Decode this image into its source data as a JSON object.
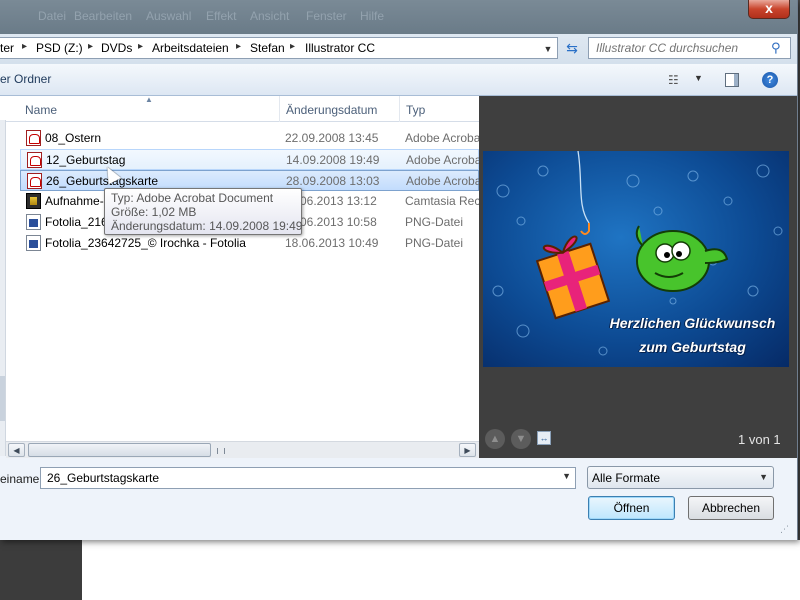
{
  "background": {
    "menu_faint": [
      "Datei",
      "Bearbeiten",
      "Auswahl",
      "Effekt",
      "Ansicht",
      "Fenster",
      "Hilfe"
    ]
  },
  "titlebar": {
    "close_label": "x"
  },
  "address": {
    "crumbs": [
      "ter",
      "PSD (Z:)",
      "DVDs",
      "Arbeitsdateien",
      "Stefan",
      "Illustrator CC"
    ],
    "search_placeholder": "Illustrator CC durchsuchen"
  },
  "toolbar": {
    "new_folder": "er Ordner"
  },
  "columns": {
    "name": "Name",
    "date": "Änderungsdatum",
    "type": "Typ"
  },
  "files": [
    {
      "name": "08_Ostern",
      "date": "22.09.2008 13:45",
      "type": "Adobe Acrobat Document",
      "icon": "pdf-icon"
    },
    {
      "name": "12_Geburtstag",
      "date": "14.09.2008 19:49",
      "type": "Adobe Acrobat Document",
      "icon": "pdf-icon"
    },
    {
      "name": "26_Geburtstagskarte",
      "date": "28.09.2008 13:03",
      "type": "Adobe Acrobat Document",
      "icon": "pdf-icon"
    },
    {
      "name": "Aufnahme-",
      "date": "06.2013 13:12",
      "type": "Camtasia Recording",
      "icon": "video-file-icon"
    },
    {
      "name": "Fotolia_216",
      "date": "06.2013 10:58",
      "type": "PNG-Datei",
      "icon": "png-file-icon"
    },
    {
      "name": "Fotolia_23642725_© Irochka - Fotolia",
      "date": "18.06.2013 10:49",
      "type": "PNG-Datei",
      "icon": "png-file-icon"
    }
  ],
  "tooltip": {
    "type": "Typ: Adobe Acrobat Document",
    "size": "Größe: 1,02 MB",
    "modified": "Änderungsdatum: 14.09.2008 19:49"
  },
  "preview": {
    "card_line1": "Herzlichen Glückwunsch",
    "card_line2": "zum Geburtstag",
    "page_counter": "1 von 1"
  },
  "bottom": {
    "filename_label": "einame:",
    "filename_value": "26_Geburtstagskarte",
    "format_selected": "Alle Formate",
    "open_label": "Öffnen",
    "cancel_label": "Abbrechen"
  },
  "colors": {
    "selection": "#c2dcfd",
    "preview_bg": "#3f3f3f",
    "card_blue": "#0d4b94",
    "close_red": "#c9442c"
  }
}
